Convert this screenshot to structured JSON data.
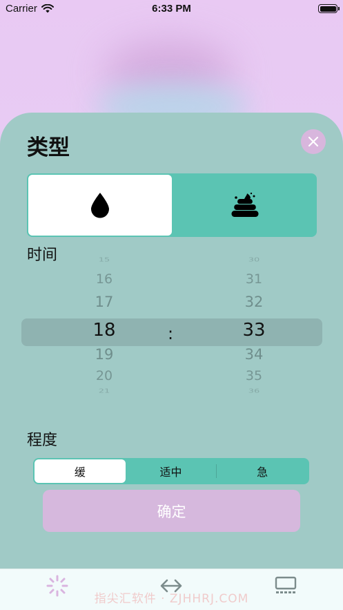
{
  "status_bar": {
    "carrier": "Carrier",
    "time": "6:33 PM"
  },
  "sheet": {
    "title": "类型",
    "type_options": [
      {
        "icon": "water-drop-icon",
        "selected": true
      },
      {
        "icon": "poop-icon",
        "selected": false
      }
    ],
    "time_label": "时间",
    "time_picker": {
      "hours": [
        "15",
        "16",
        "17",
        "18",
        "19",
        "20",
        "21"
      ],
      "minutes": [
        "30",
        "31",
        "32",
        "33",
        "34",
        "35",
        "36"
      ],
      "selected_hour": "18",
      "selected_minute": "33",
      "separator": ":"
    },
    "degree_label": "程度",
    "degree_options": [
      "缓",
      "适中",
      "急"
    ],
    "degree_selected_index": 0,
    "confirm_label": "确定"
  },
  "tab_bar": {
    "items": [
      {
        "icon": "spinner-icon"
      },
      {
        "icon": "swap-arrows-icon"
      },
      {
        "icon": "keyboard-screen-icon"
      }
    ],
    "watermark": "指尖汇软件 · ZJHHRJ.COM"
  },
  "colors": {
    "sheet_bg": "#a0cac6",
    "accent_teal": "#5bc4b3",
    "close_pink": "#d8b6dd",
    "confirm_pink": "#d6b8dd",
    "background_top": "#e9c9f3"
  }
}
